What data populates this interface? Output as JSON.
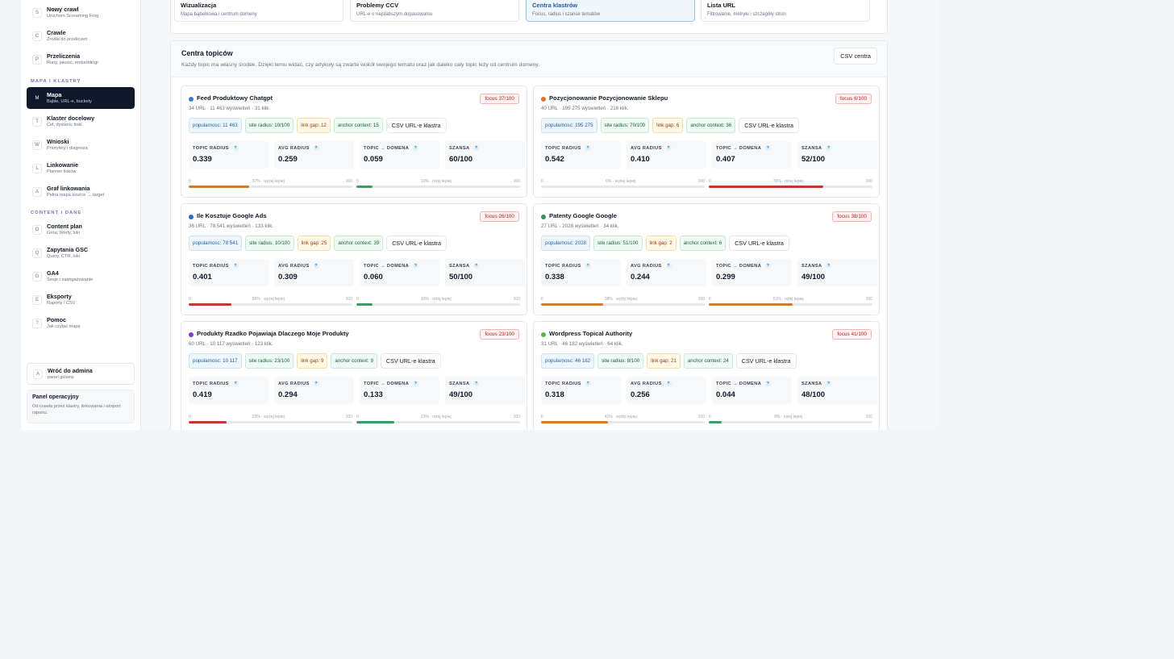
{
  "sidebar": {
    "items_top": [
      {
        "key": "S",
        "title": "Nowy crawl",
        "sub": "Uruchom Screaming Frog"
      },
      {
        "key": "C",
        "title": "Crawle",
        "sub": "Źródła do przeliczeń"
      },
      {
        "key": "P",
        "title": "Przeliczenia",
        "sub": "Runy, jakość, embeddingi"
      }
    ],
    "section_map": "MAPA I KLASTRY",
    "items_map": [
      {
        "key": "M",
        "title": "Mapa",
        "sub": "Bąble, URL-e, buckety"
      },
      {
        "key": "T",
        "title": "Klaster docelowy",
        "sub": "Cel, dystans, linki"
      },
      {
        "key": "W",
        "title": "Wnioski",
        "sub": "Priorytety i diagnoza"
      },
      {
        "key": "L",
        "title": "Linkowanie",
        "sub": "Planner linków"
      },
      {
        "key": "A",
        "title": "Graf linkowania",
        "sub": "Pełna mapa source → target"
      }
    ],
    "section_content": "CONTENT I DANE",
    "items_content": [
      {
        "key": "O",
        "title": "Content plan",
        "sub": "Grow, briefy, luki"
      },
      {
        "key": "Q",
        "title": "Zapytania GSC",
        "sub": "Query, CTR, luki"
      },
      {
        "key": "G",
        "title": "GA4",
        "sub": "Sesje i zaangażowanie"
      },
      {
        "key": "E",
        "title": "Eksporty",
        "sub": "Raporty i CSV"
      },
      {
        "key": "?",
        "title": "Pomoc",
        "sub": "Jak czytać mapę"
      }
    ],
    "admin": {
      "key": "A",
      "title": "Wróć do admina",
      "sub": "panel główny"
    },
    "ops": {
      "title": "Panel operacyjny",
      "text": "Od crawla przez klastry, linkowania i eksport raportu."
    }
  },
  "tiles": [
    {
      "title": "Wizualizacja",
      "sub": "Mapa bąbelkowa i centrum domeny"
    },
    {
      "title": "Problemy CCV",
      "sub": "URL-e o najsłabszym dopasowaniu"
    },
    {
      "title": "Centra klastrów",
      "sub": "Focus, radius i szanse tematów"
    },
    {
      "title": "Lista URL",
      "sub": "Filtrowanie, metryki i szczegóły stron"
    }
  ],
  "panel": {
    "title": "Centra topiców",
    "subtitle": "Każdy topic ma własny środek. Dzięki temu widać, czy artykuły są zwarte wokół swojego tematu oraz jak daleko cały topic leży od centrum domeny.",
    "csv_label": "CSV centra"
  },
  "labels": {
    "topic_radius": "TOPIC RADIUS",
    "avg_radius": "AVG RADIUS",
    "topic_domain": "TOPIC → DOMENA",
    "szansa": "SZANSA",
    "help": "?",
    "csv_cluster": "CSV URL-e klastra",
    "bar_min": "0",
    "bar_max": "100"
  },
  "colors": {
    "green": "#3f9a62",
    "orange": "#d07a2c",
    "red": "#c0392b"
  },
  "cards": [
    {
      "dot": "#3a7fc1",
      "title": "Feed Produktowy Chatgpt",
      "sub": "34 URL · 11 463 wyświetleń · 31 klik.",
      "focus": "focus 37/100",
      "popularnosc": "popularnosc: 11 463",
      "site_radius": "site radius: 10/100",
      "link_gap": "link gap: 12",
      "anchor": "anchor context: 15",
      "topic_radius": "0.339",
      "avg_radius": "0.259",
      "topic_domain": "0.059",
      "szansa": "60/100",
      "bar1_label": "37% · wyżej lepiej",
      "bar1": 37,
      "bar1_color": "#d07a2c",
      "bar2_label": "10% · niżej lepiej",
      "bar2": 10,
      "bar2_color": "#3f9a62"
    },
    {
      "dot": "#e0762c",
      "title": "Pozycjonowanie Pozycjonowanie Sklepu",
      "sub": "40 URL · 195 275 wyświetleń · 216 klik.",
      "focus": "focus 6/100",
      "popularnosc": "popularnosc: 195 275",
      "site_radius": "site radius: 70/100",
      "link_gap": "link gap: 6",
      "anchor": "anchor context: 36",
      "topic_radius": "0.542",
      "avg_radius": "0.410",
      "topic_domain": "0.407",
      "szansa": "52/100",
      "bar1_label": "0% · wyżej lepiej",
      "bar1": 0,
      "bar1_color": "#d07a2c",
      "bar2_label": "70% · niżej lepiej",
      "bar2": 70,
      "bar2_color": "#c0392b"
    },
    {
      "dot": "#3566c9",
      "title": "Ile Kosztuje Google Ads",
      "sub": "36 URL · 78 541 wyświetleń · 133 klik.",
      "focus": "focus 26/100",
      "popularnosc": "popularnosc: 78 541",
      "site_radius": "site radius: 10/100",
      "link_gap": "link gap: 25",
      "anchor": "anchor context: 39",
      "topic_radius": "0.401",
      "avg_radius": "0.309",
      "topic_domain": "0.060",
      "szansa": "50/100",
      "bar1_label": "26% · wyżej lepiej",
      "bar1": 26,
      "bar1_color": "#c0392b",
      "bar2_label": "10% · niżej lepiej",
      "bar2": 10,
      "bar2_color": "#3f9a62"
    },
    {
      "dot": "#3a8f5a",
      "title": "Patenty Google Google",
      "sub": "27 URL · 2028 wyświetleń · 34 klik.",
      "focus": "focus 38/100",
      "popularnosc": "popularnosc: 2028",
      "site_radius": "site radius: 51/100",
      "link_gap": "link gap: 2",
      "anchor": "anchor context: 6",
      "topic_radius": "0.338",
      "avg_radius": "0.244",
      "topic_domain": "0.299",
      "szansa": "49/100",
      "bar1_label": "38% · wyżej lepiej",
      "bar1": 38,
      "bar1_color": "#d07a2c",
      "bar2_label": "51% · niżej lepiej",
      "bar2": 51,
      "bar2_color": "#d07a2c"
    },
    {
      "dot": "#7a3fd0",
      "title": "Produkty Rzadko Pojawiaja Dlaczego Moje Produkty",
      "sub": "60 URL · 10 117 wyświetleń · 123 klik.",
      "focus": "focus 23/100",
      "popularnosc": "popularnosc: 10 117",
      "site_radius": "site radius: 23/100",
      "link_gap": "link gap: 9",
      "anchor": "anchor context: 9",
      "topic_radius": "0.419",
      "avg_radius": "0.294",
      "topic_domain": "0.133",
      "szansa": "49/100",
      "bar1_label": "23% · wyżej lepiej",
      "bar1": 23,
      "bar1_color": "#c0392b",
      "bar2_label": "23% · niżej lepiej",
      "bar2": 23,
      "bar2_color": "#3f9a62"
    },
    {
      "dot": "#5fb04a",
      "title": "Wordpress Topical Authority",
      "sub": "31 URL · 46 182 wyświetleń · 64 klik.",
      "focus": "focus 41/100",
      "popularnosc": "popularnosc: 46 182",
      "site_radius": "site radius: 8/100",
      "link_gap": "link gap: 21",
      "anchor": "anchor context: 24",
      "topic_radius": "0.318",
      "avg_radius": "0.256",
      "topic_domain": "0.044",
      "szansa": "48/100",
      "bar1_label": "41% · wyżej lepiej",
      "bar1": 41,
      "bar1_color": "#d07a2c",
      "bar2_label": "8% · niżej lepiej",
      "bar2": 8,
      "bar2_color": "#3f9a62"
    }
  ]
}
